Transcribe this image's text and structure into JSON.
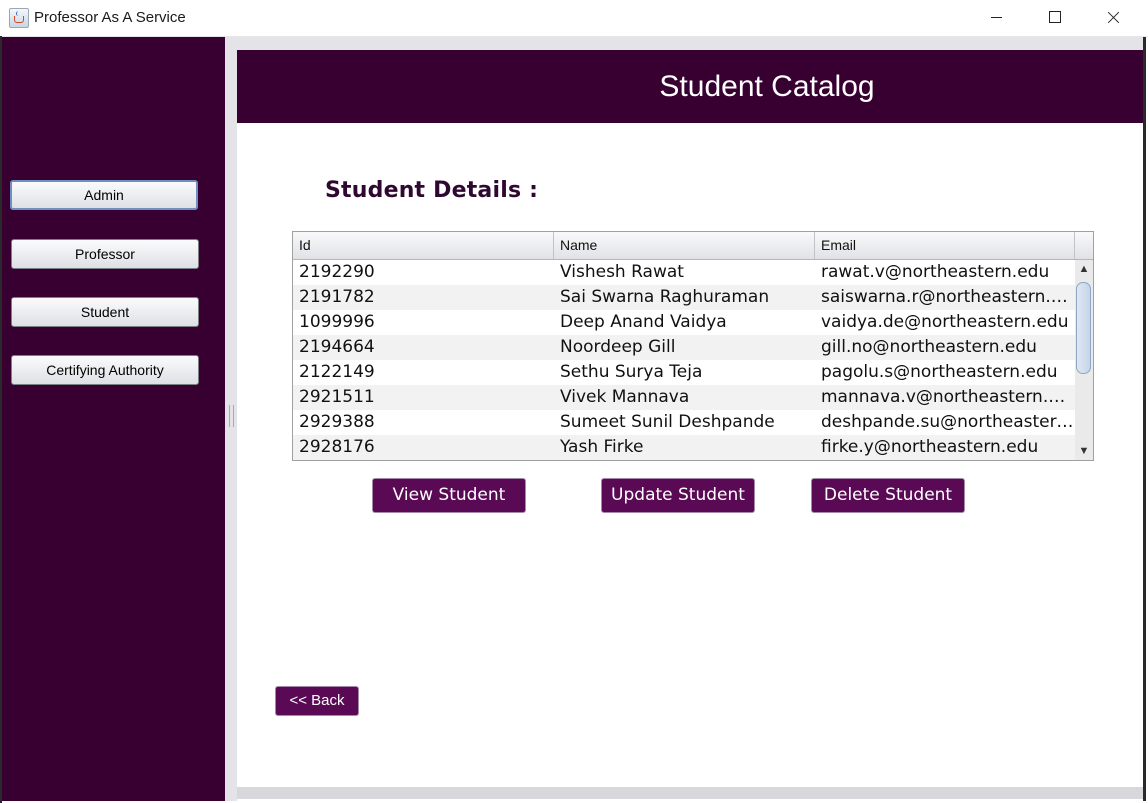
{
  "window": {
    "title": "Professor As A Service"
  },
  "sidebar": {
    "items": [
      {
        "label": "Admin"
      },
      {
        "label": "Professor"
      },
      {
        "label": "Student"
      },
      {
        "label": "Certifying Authority"
      }
    ]
  },
  "header": {
    "title": "Student Catalog"
  },
  "main": {
    "section_title": "Student Details :",
    "table": {
      "columns": [
        "Id",
        "Name",
        "Email"
      ],
      "rows": [
        [
          "2192290",
          "Vishesh Rawat",
          "rawat.v@northeastern.edu"
        ],
        [
          "2191782",
          "Sai Swarna Raghuraman",
          "saiswarna.r@northeastern.edu"
        ],
        [
          "1099996",
          "Deep Anand Vaidya",
          "vaidya.de@northeastern.edu"
        ],
        [
          "2194664",
          "Noordeep Gill",
          "gill.no@northeastern.edu"
        ],
        [
          "2122149",
          "Sethu Surya Teja",
          "pagolu.s@northeastern.edu"
        ],
        [
          "2921511",
          "Vivek Mannava",
          "mannava.v@northeastern.edu"
        ],
        [
          "2929388",
          "Sumeet Sunil Deshpande",
          "deshpande.su@northeastern...."
        ],
        [
          "2928176",
          "Yash Firke",
          "firke.y@northeastern.edu"
        ]
      ]
    },
    "buttons": {
      "view": "View Student",
      "update": "Update Student",
      "delete": "Delete Student",
      "back": "<< Back"
    }
  },
  "colors": {
    "brand_purple": "#370031",
    "button_purple": "#5a0a55"
  }
}
